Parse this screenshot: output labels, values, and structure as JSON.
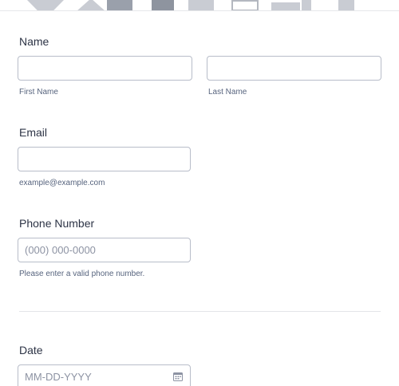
{
  "fields": {
    "name": {
      "label": "Name",
      "first_value": "",
      "last_value": "",
      "first_sublabel": "First Name",
      "last_sublabel": "Last Name"
    },
    "email": {
      "label": "Email",
      "value": "",
      "sublabel": "example@example.com"
    },
    "phone": {
      "label": "Phone Number",
      "value": "",
      "placeholder": "(000) 000-0000",
      "sublabel": "Please enter a valid phone number."
    },
    "date": {
      "label": "Date",
      "value": "",
      "placeholder": "MM-DD-YYYY",
      "icon": "calendar-icon"
    }
  },
  "colors": {
    "border": "#b8bdc9",
    "label": "#2c3345",
    "sublabel": "#57647e",
    "banner": "#c9ccd3"
  }
}
